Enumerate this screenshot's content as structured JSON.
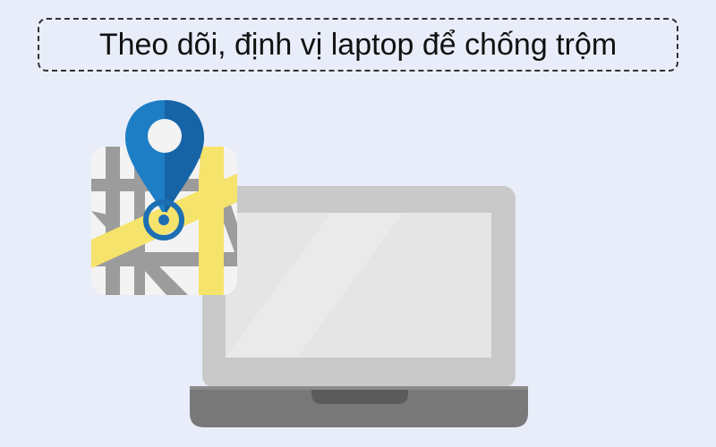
{
  "banner": {
    "title": "Theo dõi, định vị laptop để chống trộm"
  },
  "illustration": {
    "icons": [
      "map-icon",
      "location-pin-icon",
      "laptop-icon"
    ],
    "colors": {
      "background": "#e8edf9",
      "laptop_body": "#c8c8c8",
      "laptop_screen": "#e4e4e4",
      "laptop_base": "#777777",
      "map_bg": "#f2f2f2",
      "map_roads_gray": "#9a9a9a",
      "map_roads_yellow": "#f6e26b",
      "pin_blue": "#1d7ec6",
      "pin_dark_blue": "#1560a0"
    }
  }
}
